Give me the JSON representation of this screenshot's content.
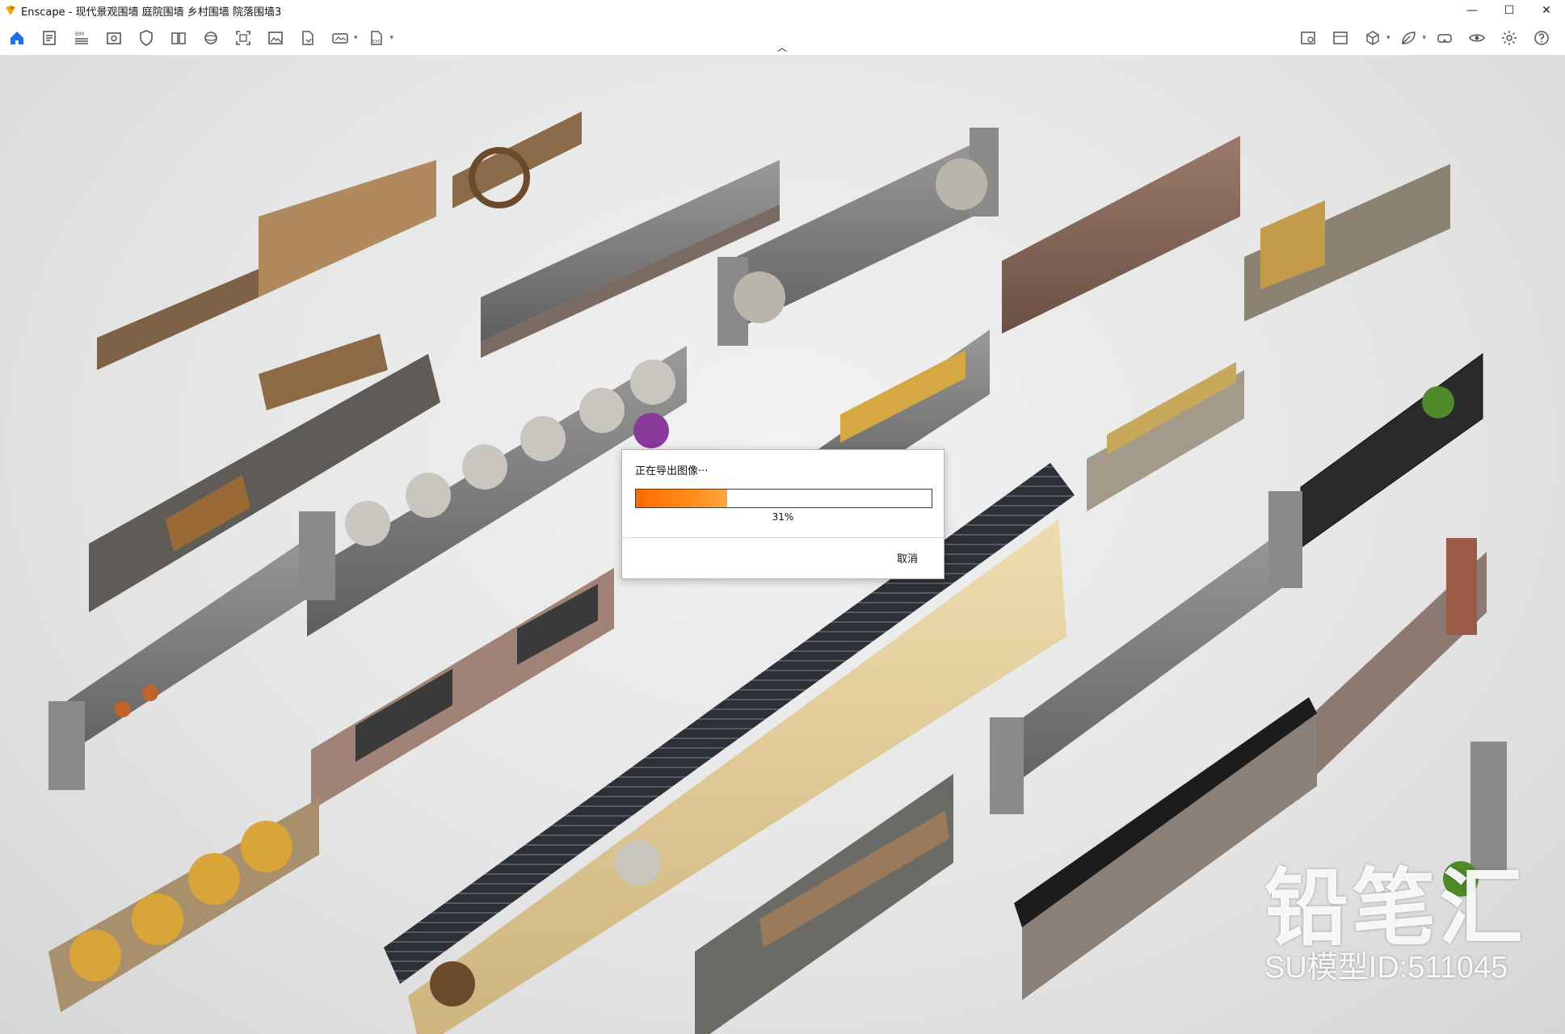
{
  "window": {
    "title": "Enscape - 现代景观围墙 庭院围墙 乡村围墙 院落围墙3",
    "controls": {
      "minimize": "—",
      "maximize": "☐",
      "close": "✕"
    }
  },
  "toolbar": {
    "left_icons": [
      "home-icon",
      "notes-icon",
      "bim-icon",
      "view-icon",
      "shield-icon",
      "book-icon",
      "sphere-icon",
      "screenshot-icon",
      "image-icon",
      "export-file-icon",
      "panorama-icon",
      "exe-export-icon"
    ],
    "right_icons": [
      "capture-icon",
      "image-gallery-icon",
      "cube-icon",
      "leaf-icon",
      "vr-headset-icon",
      "eye-icon",
      "settings-icon",
      "help-icon"
    ]
  },
  "export_dialog": {
    "title": "正在导出图像···",
    "progress_label": "31%",
    "progress_fraction": 0.31,
    "cancel_label": "取消"
  },
  "watermark": {
    "brand": "铅笔汇",
    "model_id": "SU模型ID:511045"
  },
  "colors": {
    "accent": "#ff7a00",
    "home_icon": "#1a73e8"
  }
}
